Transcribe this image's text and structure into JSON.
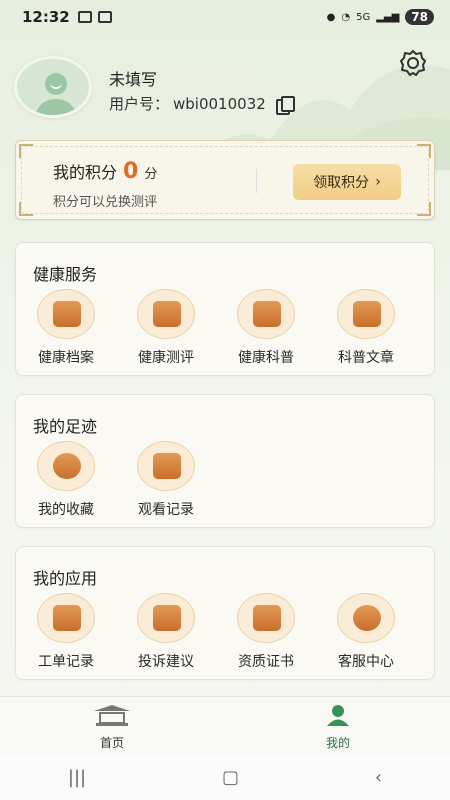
{
  "status_bar": {
    "time": "12:32",
    "network": "5G",
    "battery": "78"
  },
  "profile": {
    "nickname": "未填写",
    "uid_label": "用户号：",
    "uid_value": "wbi0010032"
  },
  "points": {
    "title": "我的积分",
    "value": "0",
    "unit": "分",
    "desc": "积分可以兑换测评",
    "button": "领取积分"
  },
  "sections": [
    {
      "title": "健康服务",
      "items": [
        {
          "label": "健康档案",
          "icon": "health-record-icon"
        },
        {
          "label": "健康测评",
          "icon": "health-assessment-icon"
        },
        {
          "label": "健康科普",
          "icon": "health-video-icon"
        },
        {
          "label": "科普文章",
          "icon": "article-book-icon"
        }
      ]
    },
    {
      "title": "我的足迹",
      "items": [
        {
          "label": "我的收藏",
          "icon": "star-icon"
        },
        {
          "label": "观看记录",
          "icon": "history-icon"
        }
      ]
    },
    {
      "title": "我的应用",
      "items": [
        {
          "label": "工单记录",
          "icon": "work-order-icon"
        },
        {
          "label": "投诉建议",
          "icon": "feedback-icon"
        },
        {
          "label": "资质证书",
          "icon": "certificate-icon"
        },
        {
          "label": "客服中心",
          "icon": "customer-service-icon"
        }
      ]
    }
  ],
  "bottom_nav": [
    {
      "label": "首页",
      "icon": "home-pavilion-icon",
      "active": false
    },
    {
      "label": "我的",
      "icon": "profile-person-icon",
      "active": true
    }
  ],
  "colors": {
    "accent": "#e06b2b",
    "active_nav": "#3a8f5a",
    "icon_gradient_top": "#e39a55",
    "icon_gradient_bottom": "#c86f2b"
  }
}
